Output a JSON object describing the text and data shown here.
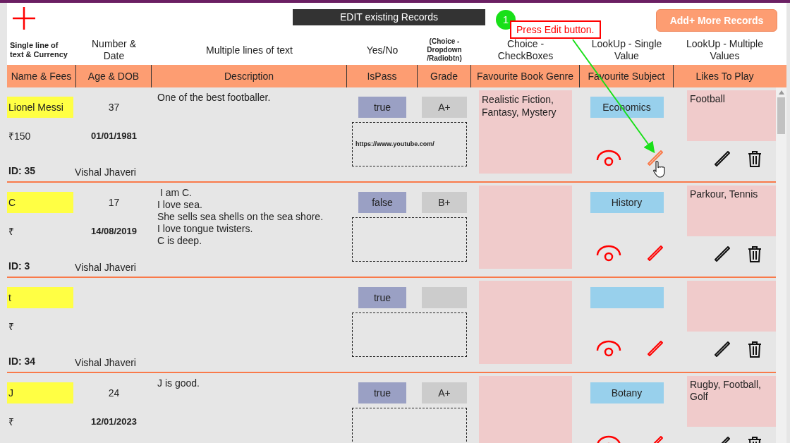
{
  "top": {
    "title": "EDIT existing Records",
    "add_button": "Add+ More Records"
  },
  "annotation": {
    "step": "1",
    "text": "Press Edit button."
  },
  "column_groups": [
    {
      "label": "Single line of text & Currency",
      "kind": "note"
    },
    {
      "label": "Number & Date",
      "kind": "plain"
    },
    {
      "label": "Multiple lines of text",
      "kind": "plain"
    },
    {
      "label": "Yes/No",
      "kind": "plain"
    },
    {
      "label": "(Choice - Dropdown /Radiobtn)",
      "kind": "note"
    },
    {
      "label": "Choice - CheckBoxes",
      "kind": "plain"
    },
    {
      "label": "LookUp - Single Value",
      "kind": "plain"
    },
    {
      "label": "LookUp - Multiple Values",
      "kind": "plain"
    }
  ],
  "columns": [
    "Name & Fees",
    "Age & DOB",
    "Description",
    "IsPass",
    "Grade",
    "Favourite Book Genre",
    "Favourite Subject",
    "Likes To Play"
  ],
  "rows": [
    {
      "name": "Lionel Messi",
      "fees": "₹150",
      "id": "ID: 35",
      "age": "37",
      "dob": "01/01/1981",
      "author": "Vishal Jhaveri",
      "description": "One of the best footballer.",
      "is_pass": "true",
      "grade": "A+",
      "link": "https://www.youtube.com/",
      "genre": "Realistic Fiction, Fantasy, Mystery",
      "subject": "Economics",
      "likes": "Football",
      "edit_hovered": true
    },
    {
      "name": "C",
      "fees": "₹",
      "id": "ID: 3",
      "age": "17",
      "dob": "14/08/2019",
      "author": "Vishal Jhaveri",
      "description": " I am C.\nI love sea.\nShe sells sea shells on the sea shore.\nI love tongue twisters.\nC is deep.",
      "is_pass": "false",
      "grade": "B+",
      "genre": "",
      "subject": "History",
      "likes": "Parkour, Tennis",
      "edit_hovered": false
    },
    {
      "name": "t",
      "fees": "₹",
      "id": "ID: 34",
      "author": "Vishal Jhaveri",
      "is_pass": "true",
      "edit_hovered": false
    },
    {
      "name": "J",
      "fees": "₹",
      "age": "24",
      "dob": "12/01/2023",
      "description": "J is good.",
      "is_pass": "true",
      "grade": "A+",
      "subject": "Botany",
      "likes": "Rugby, Football, Golf",
      "edit_hovered": false
    }
  ]
}
